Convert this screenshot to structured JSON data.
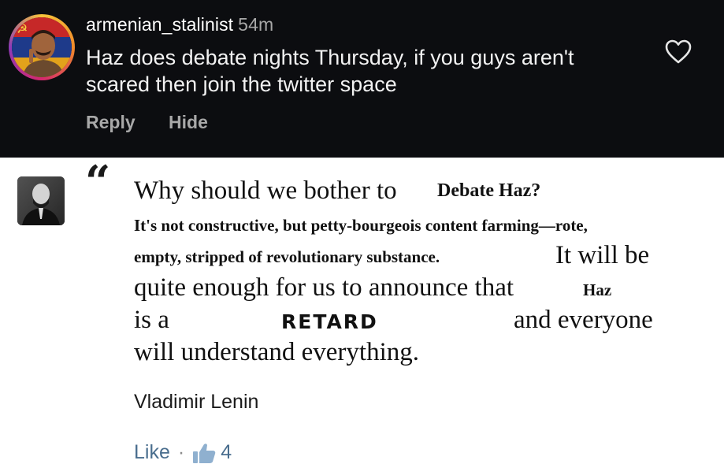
{
  "comment": {
    "username": "armenian_stalinist",
    "timestamp": "54m",
    "text": "Haz does debate nights Thursday, if you guys aren't scared then join the twitter space",
    "reply_label": "Reply",
    "hide_label": "Hide",
    "heart_icon": "heart-outline-icon"
  },
  "quote": {
    "line1_a": "Why should we bother to",
    "line1_b": "Debate Haz?",
    "line2": "It's not constructive, but petty-bourgeois content farming—rote,",
    "line3_a": "empty, stripped of revolutionary substance.",
    "line3_b": "It will be",
    "line4_a": "quite enough for us to announce that",
    "line4_b": "Haz",
    "line5_a": "is a",
    "line5_b": "RETARD",
    "line5_c": "and everyone",
    "line6": "will understand everything.",
    "author": "Vladimir Lenin",
    "like_label": "Like",
    "separator": "·",
    "like_count": "4",
    "thumb_icon": "thumbs-up-icon",
    "quote_icon": "quote-mark-icon"
  },
  "colors": {
    "dark_background": "#0c0d10",
    "like_blue": "#4a6e8e",
    "muted_text": "#a8a8a8"
  }
}
